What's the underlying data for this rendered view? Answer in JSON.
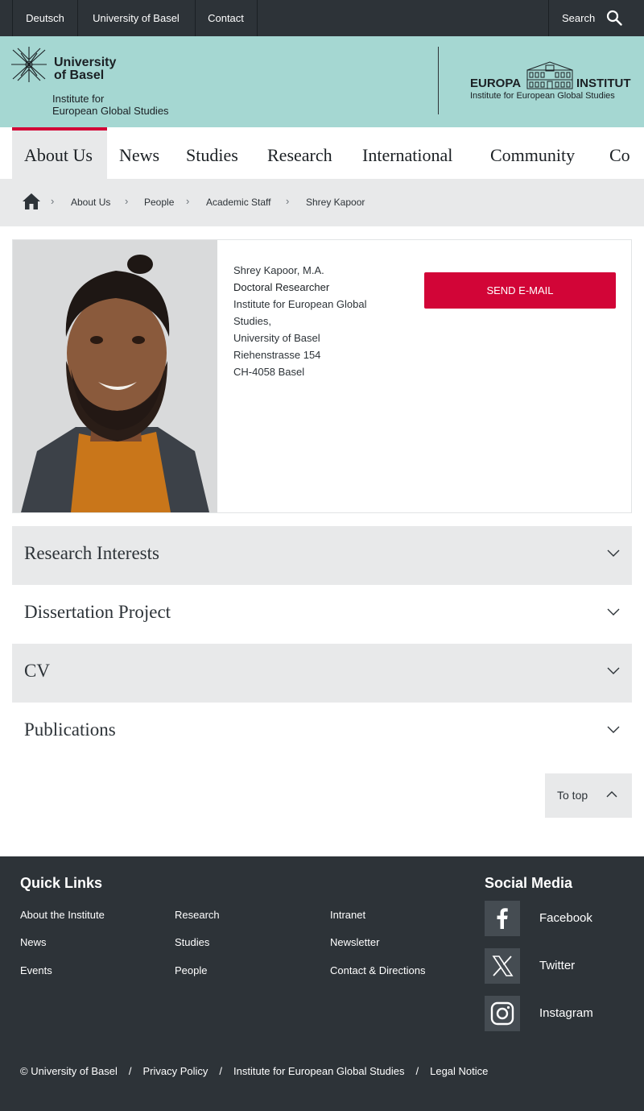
{
  "topbar": {
    "links": [
      "Deutsch",
      "University of Basel",
      "Contact"
    ],
    "search_label": "Search"
  },
  "header": {
    "university": [
      "University",
      "of Basel"
    ],
    "institute": [
      "Institute for",
      "European Global Studies"
    ],
    "europa_word1": "EUROPA",
    "europa_word2": "INSTITUT",
    "europa_sub": "Institute for European Global Studies"
  },
  "nav": {
    "items": [
      "About Us",
      "News",
      "Studies",
      "Research",
      "International",
      "Community",
      "Co"
    ],
    "active": "About Us"
  },
  "breadcrumb": [
    "About Us",
    "People",
    "Academic Staff",
    "Shrey Kapoor"
  ],
  "profile": {
    "name": "Shrey Kapoor, M.A.",
    "role": "Doctoral Researcher",
    "address": [
      "Institute for European Global",
      "Studies,",
      "University of Basel",
      "Riehenstrasse 154",
      "CH-4058 Basel"
    ],
    "email_button": "SEND E-MAIL"
  },
  "accordions": [
    "Research Interests",
    "Dissertation Project",
    "CV",
    "Publications"
  ],
  "to_top": "To top",
  "footer": {
    "quick_links_title": "Quick Links",
    "quick_links": [
      [
        "About the Institute",
        "News",
        "Events"
      ],
      [
        "Research",
        "Studies",
        "People"
      ],
      [
        "Intranet",
        "Newsletter",
        "Contact & Directions"
      ]
    ],
    "social_title": "Social Media",
    "social": [
      "Facebook",
      "Twitter",
      "Instagram"
    ],
    "bottom": [
      "© University of Basel",
      "Privacy Policy",
      "Institute for European Global Studies",
      "Legal Notice"
    ],
    "separator": "/"
  },
  "colors": {
    "accent_red": "#d20537",
    "header_mint": "#a5d7d2",
    "dark": "#2d3338"
  }
}
